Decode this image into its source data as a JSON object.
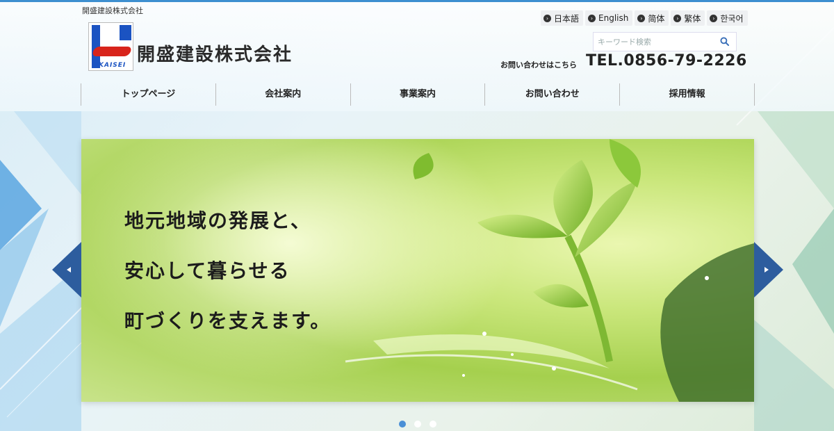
{
  "header": {
    "tagline": "開盛建設株式会社",
    "company_name": "開盛建設株式会社",
    "logo_text": "KAISEI",
    "languages": [
      "日本語",
      "English",
      "简体",
      "繁体",
      "한국어"
    ],
    "search_placeholder": "キーワード検索",
    "contact_label": "お問い合わせはこちら",
    "tel": "TEL.0856-79-2226"
  },
  "nav": {
    "items": [
      "トップページ",
      "会社案内",
      "事業案内",
      "お問い合わせ",
      "採用情報"
    ]
  },
  "slider": {
    "copy": [
      "地元地域の発展と、",
      "安心して暮らせる",
      "町づくりを支えます。"
    ],
    "prev_icon": "chevron-left-icon",
    "next_icon": "chevron-right-icon",
    "active_slide": 1,
    "slide_count": 3
  },
  "colors": {
    "accent": "#3d8fd0",
    "brand_blue": "#1b53c2",
    "brand_red": "#d8241b",
    "arrow_blue": "#2d5d9e",
    "dot_active": "#4a8fd6"
  }
}
